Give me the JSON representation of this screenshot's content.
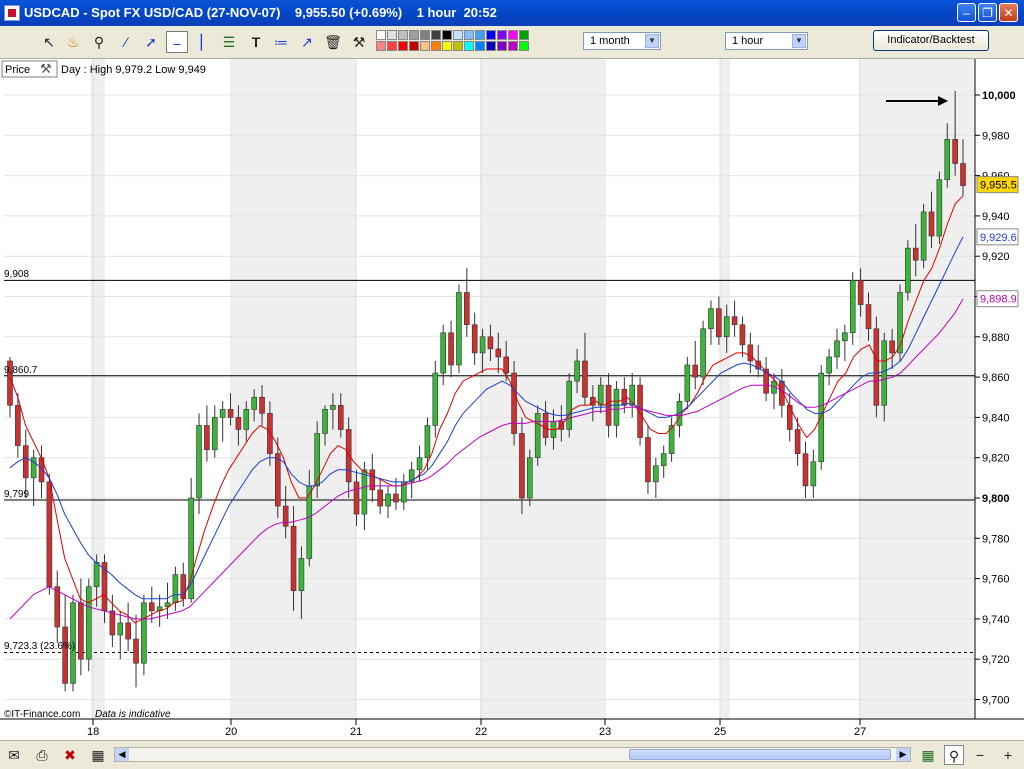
{
  "window": {
    "title": "USDCAD - Spot FX USD/CAD (27-NOV-07)    9,955.50 (+0.69%)    1 hour  20:52",
    "buttons": [
      "minimize",
      "restore",
      "close"
    ]
  },
  "toolbar": {
    "tools": [
      "cursor-icon",
      "alarm-bell-icon",
      "zoom-icon",
      "line-draw-icon",
      "trend-line-icon",
      "crosshair-icon",
      "vertical-line-icon",
      "fibonacci-icon",
      "text-tool-icon",
      "channel-icon",
      "arrow-tool-icon",
      "trash-icon",
      "settings-tools-icon"
    ],
    "palette": [
      "#ffffff",
      "#e0e0e0",
      "#c0c0c0",
      "#a0a0a0",
      "#808080",
      "#404040",
      "#000000",
      "#c0e0ff",
      "#80c0ff",
      "#40a0ff",
      "#0000ff",
      "#8000ff",
      "#ff00ff",
      "#00a000",
      "#ff8080",
      "#ff4040",
      "#ff0000",
      "#c00000",
      "#ffc080",
      "#ff8000",
      "#ffff00",
      "#c0c000",
      "#00ffff",
      "#0080ff",
      "#0000c0",
      "#8000c0",
      "#c000c0",
      "#00ff00"
    ],
    "period_select": "1 month",
    "interval_select": "1 hour",
    "indicator_button": "Indicator/Backtest"
  },
  "chart_header": {
    "price_label": "Price",
    "day_info": "Day : High 9,979.2 Low 9,949"
  },
  "overlay_labels": {
    "line1": "9,908",
    "line2": "9,860.7",
    "line3": "9,799",
    "line4": "9,723.3 (23.6%)",
    "copyright": "©IT-Finance.com",
    "disclaimer": "Data is indicative"
  },
  "price_tags": [
    {
      "value": "9,955.5",
      "bg": "#ffd700",
      "color": "#000000"
    },
    {
      "value": "9,929.6",
      "bg": "#ffffff",
      "color": "#1a3fd0"
    },
    {
      "value": "9,898.9",
      "bg": "#ffffff",
      "color": "#c000c0"
    }
  ],
  "colors": {
    "up_candle": "#3cb43c",
    "down_candle": "#c83232",
    "ma_red": "#e00000",
    "ma_blue": "#1a3fd0",
    "ma_magenta": "#c000c0",
    "weekend_shade": "#efefef"
  },
  "chart_data": {
    "type": "line",
    "title": "USDCAD - Spot FX USD/CAD (27-NOV-07)",
    "x_ticks": [
      "18",
      "20",
      "21",
      "22",
      "23",
      "25",
      "27"
    ],
    "ylim": [
      9690,
      10020
    ],
    "y_ticks": [
      "10,000",
      "9,980",
      "9,960",
      "9,940",
      "9,920",
      "9,900",
      "9,880",
      "9,860",
      "9,840",
      "9,820",
      "9,800",
      "9,780",
      "9,760",
      "9,740",
      "9,720",
      "9,700"
    ],
    "horizontal_lines": [
      9908,
      9860.7,
      9799
    ],
    "dashed_line": 9723.3,
    "candles": {
      "ohlc": [
        [
          9868,
          9870,
          9840,
          9846
        ],
        [
          9846,
          9852,
          9820,
          9826
        ],
        [
          9826,
          9834,
          9800,
          9810
        ],
        [
          9810,
          9824,
          9796,
          9820
        ],
        [
          9820,
          9826,
          9800,
          9808
        ],
        [
          9808,
          9812,
          9752,
          9756
        ],
        [
          9756,
          9764,
          9728,
          9736
        ],
        [
          9736,
          9752,
          9704,
          9708
        ],
        [
          9708,
          9752,
          9704,
          9748
        ],
        [
          9748,
          9760,
          9712,
          9720
        ],
        [
          9720,
          9760,
          9714,
          9756
        ],
        [
          9756,
          9772,
          9746,
          9768
        ],
        [
          9768,
          9772,
          9738,
          9744
        ],
        [
          9744,
          9752,
          9726,
          9732
        ],
        [
          9732,
          9744,
          9720,
          9738
        ],
        [
          9738,
          9748,
          9724,
          9730
        ],
        [
          9730,
          9742,
          9706,
          9718
        ],
        [
          9718,
          9752,
          9712,
          9748
        ],
        [
          9748,
          9756,
          9738,
          9744
        ],
        [
          9744,
          9752,
          9736,
          9746
        ],
        [
          9746,
          9758,
          9740,
          9748
        ],
        [
          9748,
          9766,
          9744,
          9762
        ],
        [
          9762,
          9768,
          9746,
          9750
        ],
        [
          9750,
          9810,
          9748,
          9800
        ],
        [
          9800,
          9842,
          9792,
          9836
        ],
        [
          9836,
          9846,
          9818,
          9824
        ],
        [
          9824,
          9846,
          9820,
          9840
        ],
        [
          9840,
          9848,
          9828,
          9844
        ],
        [
          9844,
          9852,
          9836,
          9840
        ],
        [
          9840,
          9846,
          9826,
          9834
        ],
        [
          9834,
          9848,
          9828,
          9844
        ],
        [
          9844,
          9854,
          9838,
          9850
        ],
        [
          9850,
          9856,
          9836,
          9842
        ],
        [
          9842,
          9848,
          9816,
          9822
        ],
        [
          9822,
          9830,
          9790,
          9796
        ],
        [
          9796,
          9806,
          9780,
          9786
        ],
        [
          9786,
          9796,
          9744,
          9754
        ],
        [
          9754,
          9776,
          9740,
          9770
        ],
        [
          9770,
          9814,
          9766,
          9806
        ],
        [
          9806,
          9838,
          9800,
          9832
        ],
        [
          9832,
          9846,
          9826,
          9844
        ],
        [
          9844,
          9852,
          9834,
          9846
        ],
        [
          9846,
          9852,
          9830,
          9834
        ],
        [
          9834,
          9840,
          9800,
          9808
        ],
        [
          9808,
          9814,
          9786,
          9792
        ],
        [
          9792,
          9818,
          9784,
          9814
        ],
        [
          9814,
          9822,
          9798,
          9804
        ],
        [
          9804,
          9810,
          9792,
          9796
        ],
        [
          9796,
          9806,
          9790,
          9802
        ],
        [
          9802,
          9810,
          9794,
          9798
        ],
        [
          9798,
          9812,
          9794,
          9808
        ],
        [
          9808,
          9818,
          9800,
          9814
        ],
        [
          9814,
          9826,
          9808,
          9820
        ],
        [
          9820,
          9840,
          9814,
          9836
        ],
        [
          9836,
          9868,
          9830,
          9862
        ],
        [
          9862,
          9886,
          9856,
          9882
        ],
        [
          9882,
          9888,
          9860,
          9866
        ],
        [
          9866,
          9906,
          9862,
          9902
        ],
        [
          9902,
          9914,
          9880,
          9886
        ],
        [
          9886,
          9892,
          9866,
          9872
        ],
        [
          9872,
          9884,
          9862,
          9880
        ],
        [
          9880,
          9886,
          9868,
          9874
        ],
        [
          9874,
          9882,
          9862,
          9870
        ],
        [
          9870,
          9878,
          9858,
          9862
        ],
        [
          9862,
          9868,
          9826,
          9832
        ],
        [
          9832,
          9840,
          9792,
          9800
        ],
        [
          9800,
          9824,
          9796,
          9820
        ],
        [
          9820,
          9846,
          9816,
          9842
        ],
        [
          9842,
          9848,
          9826,
          9830
        ],
        [
          9830,
          9844,
          9824,
          9838
        ],
        [
          9838,
          9846,
          9828,
          9834
        ],
        [
          9834,
          9862,
          9830,
          9858
        ],
        [
          9858,
          9874,
          9852,
          9868
        ],
        [
          9868,
          9882,
          9846,
          9850
        ],
        [
          9850,
          9856,
          9838,
          9846
        ],
        [
          9846,
          9860,
          9842,
          9856
        ],
        [
          9856,
          9862,
          9830,
          9836
        ],
        [
          9836,
          9858,
          9830,
          9854
        ],
        [
          9854,
          9860,
          9842,
          9846
        ],
        [
          9846,
          9862,
          9840,
          9856
        ],
        [
          9856,
          9860,
          9826,
          9830
        ],
        [
          9830,
          9836,
          9802,
          9808
        ],
        [
          9808,
          9820,
          9800,
          9816
        ],
        [
          9816,
          9826,
          9810,
          9822
        ],
        [
          9822,
          9840,
          9818,
          9836
        ],
        [
          9836,
          9852,
          9830,
          9848
        ],
        [
          9848,
          9870,
          9844,
          9866
        ],
        [
          9866,
          9878,
          9854,
          9860
        ],
        [
          9860,
          9888,
          9856,
          9884
        ],
        [
          9884,
          9898,
          9876,
          9894
        ],
        [
          9894,
          9900,
          9876,
          9880
        ],
        [
          9880,
          9896,
          9872,
          9890
        ],
        [
          9890,
          9898,
          9880,
          9886
        ],
        [
          9886,
          9890,
          9870,
          9876
        ],
        [
          9876,
          9882,
          9862,
          9868
        ],
        [
          9868,
          9876,
          9860,
          9864
        ],
        [
          9864,
          9870,
          9848,
          9852
        ],
        [
          9852,
          9862,
          9844,
          9858
        ],
        [
          9858,
          9864,
          9840,
          9846
        ],
        [
          9846,
          9852,
          9828,
          9834
        ],
        [
          9834,
          9840,
          9816,
          9822
        ],
        [
          9822,
          9828,
          9800,
          9806
        ],
        [
          9806,
          9824,
          9800,
          9818
        ],
        [
          9818,
          9866,
          9814,
          9862
        ],
        [
          9862,
          9874,
          9856,
          9870
        ],
        [
          9870,
          9884,
          9864,
          9878
        ],
        [
          9878,
          9886,
          9868,
          9882
        ],
        [
          9882,
          9912,
          9876,
          9908
        ],
        [
          9908,
          9914,
          9890,
          9896
        ],
        [
          9896,
          9902,
          9878,
          9884
        ],
        [
          9884,
          9890,
          9840,
          9846
        ],
        [
          9846,
          9882,
          9838,
          9878
        ],
        [
          9878,
          9884,
          9864,
          9872
        ],
        [
          9872,
          9906,
          9868,
          9902
        ],
        [
          9902,
          9928,
          9898,
          9924
        ],
        [
          9924,
          9936,
          9910,
          9918
        ],
        [
          9918,
          9946,
          9914,
          9942
        ],
        [
          9942,
          9952,
          9924,
          9930
        ],
        [
          9930,
          9962,
          9926,
          9958
        ],
        [
          9958,
          9986,
          9954,
          9978
        ],
        [
          9978,
          10002,
          9960,
          9966
        ],
        [
          9966,
          9978,
          9950,
          9955
        ]
      ]
    },
    "series": [
      {
        "name": "",
        "color": "#e00000",
        "values": [
          9860,
          9850,
          9836,
          9828,
          9820,
          9810,
          9790,
          9770,
          9760,
          9750,
          9748,
          9750,
          9752,
          9748,
          9744,
          9742,
          9738,
          9740,
          9742,
          9744,
          9745,
          9748,
          9749,
          9758,
          9772,
          9785,
          9796,
          9806,
          9814,
          9820,
          9826,
          9832,
          9836,
          9834,
          9828,
          9820,
          9808,
          9800,
          9800,
          9806,
          9814,
          9822,
          9826,
          9824,
          9818,
          9814,
          9812,
          9810,
          9808,
          9806,
          9806,
          9808,
          9810,
          9814,
          9822,
          9834,
          9842,
          9852,
          9858,
          9860,
          9862,
          9864,
          9864,
          9864,
          9858,
          9848,
          9840,
          9838,
          9836,
          9834,
          9834,
          9838,
          9844,
          9846,
          9846,
          9848,
          9846,
          9848,
          9848,
          9850,
          9846,
          9840,
          9834,
          9832,
          9832,
          9836,
          9842,
          9846,
          9852,
          9860,
          9866,
          9868,
          9870,
          9872,
          9872,
          9870,
          9866,
          9862,
          9858,
          9852,
          9844,
          9836,
          9830,
          9834,
          9842,
          9850,
          9858,
          9862,
          9870,
          9874,
          9876,
          9868,
          9868,
          9870,
          9876,
          9888,
          9898,
          9908,
          9914,
          9924,
          9936,
          9946,
          9950
        ]
      },
      {
        "name": "",
        "color": "#1a3fd0",
        "values": [
          9815,
          9818,
          9820,
          9818,
          9815,
          9810,
          9802,
          9792,
          9785,
          9778,
          9772,
          9768,
          9765,
          9762,
          9758,
          9755,
          9752,
          9750,
          9750,
          9750,
          9750,
          9752,
          9752,
          9756,
          9764,
          9772,
          9780,
          9788,
          9796,
          9802,
          9808,
          9814,
          9818,
          9820,
          9820,
          9818,
          9812,
          9808,
          9806,
          9806,
          9808,
          9812,
          9814,
          9814,
          9813,
          9812,
          9811,
          9810,
          9809,
          9808,
          9808,
          9808,
          9810,
          9812,
          9816,
          9822,
          9828,
          9836,
          9842,
          9846,
          9850,
          9854,
          9856,
          9858,
          9856,
          9852,
          9848,
          9846,
          9844,
          9842,
          9841,
          9841,
          9842,
          9843,
          9844,
          9845,
          9845,
          9846,
          9846,
          9847,
          9846,
          9844,
          9842,
          9840,
          9840,
          9841,
          9843,
          9846,
          9850,
          9854,
          9858,
          9862,
          9864,
          9866,
          9867,
          9866,
          9864,
          9862,
          9860,
          9857,
          9852,
          9848,
          9844,
          9842,
          9842,
          9844,
          9848,
          9852,
          9856,
          9860,
          9862,
          9862,
          9863,
          9865,
          9868,
          9874,
          9882,
          9890,
          9898,
          9906,
          9914,
          9922,
          9929.6
        ]
      },
      {
        "name": "",
        "color": "#c000c0",
        "values": [
          9740,
          9744,
          9748,
          9752,
          9754,
          9756,
          9754,
          9752,
          9750,
          9748,
          9746,
          9745,
          9744,
          9743,
          9742,
          9741,
          9740,
          9740,
          9740,
          9741,
          9742,
          9743,
          9744,
          9746,
          9750,
          9754,
          9758,
          9762,
          9766,
          9770,
          9774,
          9778,
          9782,
          9785,
          9787,
          9788,
          9788,
          9789,
          9790,
          9792,
          9795,
          9798,
          9801,
          9803,
          9804,
          9805,
          9806,
          9806,
          9806,
          9806,
          9806,
          9807,
          9808,
          9809,
          9811,
          9814,
          9817,
          9821,
          9824,
          9827,
          9830,
          9832,
          9834,
          9836,
          9837,
          9837,
          9837,
          9838,
          9838,
          9838,
          9838,
          9839,
          9840,
          9841,
          9842,
          9843,
          9843,
          9844,
          9844,
          9845,
          9845,
          9844,
          9843,
          9842,
          9841,
          9841,
          9841,
          9842,
          9843,
          9845,
          9847,
          9849,
          9851,
          9853,
          9855,
          9856,
          9856,
          9856,
          9855,
          9853,
          9850,
          9847,
          9845,
          9845,
          9846,
          9848,
          9850,
          9852,
          9854,
          9856,
          9858,
          9858,
          9859,
          9860,
          9862,
          9866,
          9870,
          9874,
          9878,
          9882,
          9887,
          9892,
          9898.9
        ]
      }
    ]
  }
}
